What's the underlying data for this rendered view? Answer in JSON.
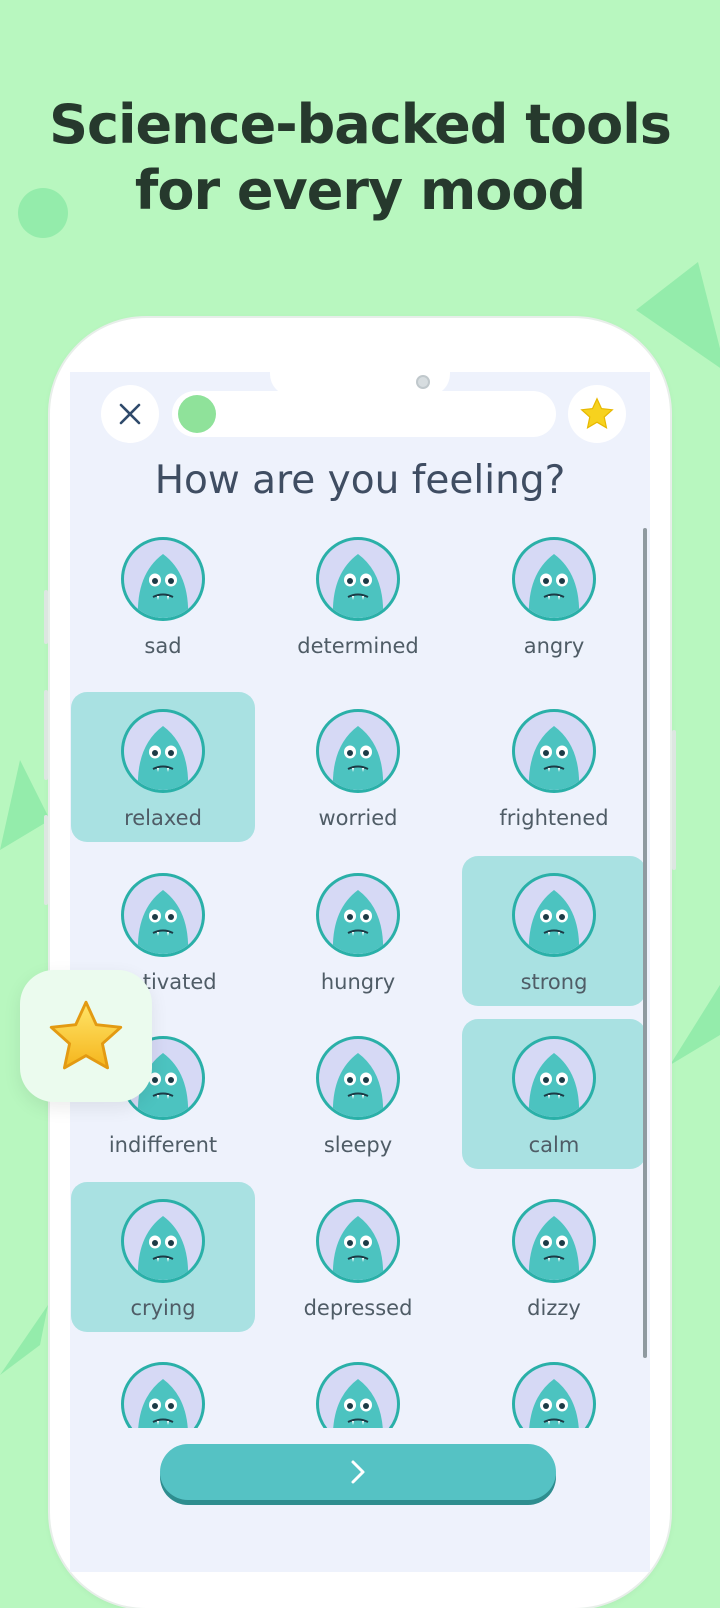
{
  "headline": {
    "line1": "Science-backed tools",
    "line2": "for every mood"
  },
  "top_bar": {
    "close_icon": "close-icon",
    "favorite_icon": "star-icon",
    "progress": 0.05
  },
  "question": "How are you feeling?",
  "moods": [
    {
      "label": "sad",
      "selected": false
    },
    {
      "label": "determined",
      "selected": false
    },
    {
      "label": "angry",
      "selected": false
    },
    {
      "label": "relaxed",
      "selected": true
    },
    {
      "label": "worried",
      "selected": false
    },
    {
      "label": "frightened",
      "selected": false
    },
    {
      "label": "motivated",
      "selected": false
    },
    {
      "label": "hungry",
      "selected": false
    },
    {
      "label": "strong",
      "selected": true
    },
    {
      "label": "indifferent",
      "selected": false
    },
    {
      "label": "sleepy",
      "selected": false
    },
    {
      "label": "calm",
      "selected": true
    },
    {
      "label": "crying",
      "selected": true
    },
    {
      "label": "depressed",
      "selected": false
    },
    {
      "label": "dizzy",
      "selected": false
    },
    {
      "label": "",
      "selected": false
    },
    {
      "label": "",
      "selected": false
    },
    {
      "label": "",
      "selected": false
    }
  ],
  "next_button": {
    "icon": "chevron-right-icon"
  },
  "floating_badge": {
    "icon": "star-icon"
  },
  "colors": {
    "background": "#b8f7bf",
    "accent": "#55c2c4",
    "selected": "#a9e1e2",
    "avatar_ring": "#2ab0a8"
  }
}
